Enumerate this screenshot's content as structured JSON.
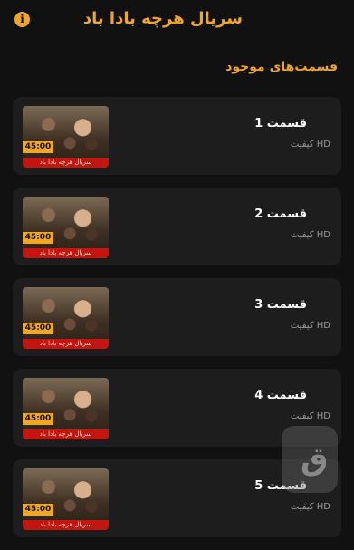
{
  "header": {
    "title": "سریال هرچه بادا باد",
    "info_icon": "info-icon",
    "info_glyph": "i"
  },
  "section": {
    "title": "قسمت‌های موجود"
  },
  "episodes": [
    {
      "title": "قسمت 1",
      "quality": "HD کیفیت",
      "duration": "45:00",
      "strip": "سریال هرچه بادا باد"
    },
    {
      "title": "قسمت 2",
      "quality": "HD کیفیت",
      "duration": "45:00",
      "strip": "سریال هرچه بادا باد"
    },
    {
      "title": "قسمت 3",
      "quality": "HD کیفیت",
      "duration": "45:00",
      "strip": "سریال هرچه بادا باد"
    },
    {
      "title": "قسمت 4",
      "quality": "HD کیفیت",
      "duration": "45:00",
      "strip": "سریال هرچه بادا باد"
    },
    {
      "title": "قسمت 5",
      "quality": "HD کیفیت",
      "duration": "45:00",
      "strip": "سریال هرچه بادا باد"
    }
  ],
  "colors": {
    "accent": "#f0a52c",
    "background": "#111111",
    "card": "#1d1d1d"
  }
}
